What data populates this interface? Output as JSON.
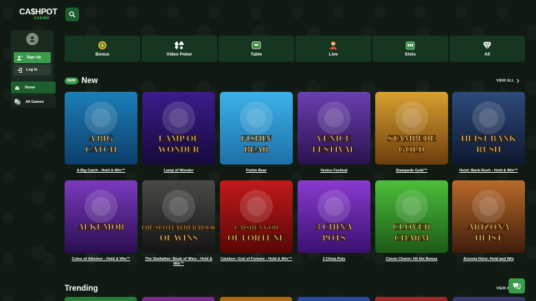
{
  "brand": {
    "name": "CA$HPOT",
    "sub": "CASINO"
  },
  "sidebar": {
    "signup_label": "Sign Up",
    "login_label": "Log In",
    "items": [
      {
        "label": "Home"
      },
      {
        "label": "All Games"
      }
    ]
  },
  "categories": [
    {
      "label": "Bonus",
      "icon": "bonus-badge-icon"
    },
    {
      "label": "Video Poker",
      "icon": "card-suits-icon"
    },
    {
      "label": "Table",
      "icon": "table-icon"
    },
    {
      "label": "Live",
      "icon": "dealer-icon"
    },
    {
      "label": "Slots",
      "icon": "slot-machine-icon"
    },
    {
      "label": "All",
      "icon": "diamond-icon"
    }
  ],
  "sections": {
    "new": {
      "badge": "NEW",
      "title": "New",
      "view_all": "VIEW ALL"
    },
    "trending": {
      "title": "Trending",
      "view_all": "VIEW A"
    }
  },
  "games": [
    {
      "name": "A Big Catch - Hold & Win™",
      "art": "A BIG CATCH",
      "colors": [
        "#1c7fb8",
        "#0c3e6b"
      ]
    },
    {
      "name": "Lamp of Wonder",
      "art": "LAMP OF WONDER",
      "colors": [
        "#3b1c8c",
        "#150a3c"
      ]
    },
    {
      "name": "Fishin Bear",
      "art": "FISHIN BEAR",
      "colors": [
        "#3cb2e8",
        "#1e6fa8"
      ]
    },
    {
      "name": "Venice Festival",
      "art": "VENICE FESTIVAL",
      "colors": [
        "#6a3fb0",
        "#2a1250"
      ]
    },
    {
      "name": "Stampede Gold™",
      "art": "STAMPEDE GOLD",
      "colors": [
        "#d9a030",
        "#6b3d0c"
      ]
    },
    {
      "name": "Heist: Bank Rush - Hold & Win™",
      "art": "HEIST BANK RUSH",
      "colors": [
        "#2d4a7a",
        "#0e1830"
      ]
    },
    {
      "name": "Coins of Alkemor - Hold & Win™",
      "art": "ALKEMOR",
      "colors": [
        "#7b3ac0",
        "#2a0e4f"
      ]
    },
    {
      "name": "The Slotfather: Book of Wins - Hold & Win™",
      "art": "THE SLOTFATHER BOOK OF WINS",
      "colors": [
        "#4a4a48",
        "#141414"
      ]
    },
    {
      "name": "Caishen: God of Fortune - Hold & Win™",
      "art": "CAISHEN GOD OF FORTUNE",
      "colors": [
        "#c21a1a",
        "#5a0606"
      ]
    },
    {
      "name": "3 China Pots",
      "art": "3 CHINA POTS",
      "colors": [
        "#8a3ad0",
        "#3a1070"
      ]
    },
    {
      "name": "Clover Charm: Hit the Bonus",
      "art": "CLOVER CHARM",
      "colors": [
        "#4bbf3a",
        "#1c5a16"
      ]
    },
    {
      "name": "Arizona Heist: Hold and Win",
      "art": "ARIZONA HEIST",
      "colors": [
        "#b86a2a",
        "#3e1c0a"
      ]
    }
  ],
  "colors": {
    "accent": "#3a9b4c",
    "panel": "#173621",
    "background": "#101a12"
  }
}
